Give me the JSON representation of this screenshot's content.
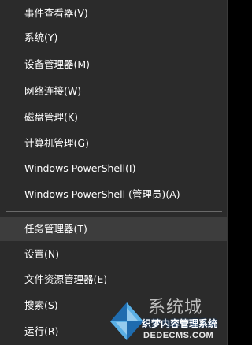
{
  "menu": {
    "items": [
      {
        "label": "事件查看器(V)"
      },
      {
        "label": "系统(Y)"
      },
      {
        "label": "设备管理器(M)"
      },
      {
        "label": "网络连接(W)"
      },
      {
        "label": "磁盘管理(K)"
      },
      {
        "label": "计算机管理(G)"
      },
      {
        "label": "Windows PowerShell(I)"
      },
      {
        "label": "Windows PowerShell (管理员)(A)"
      },
      {
        "label": "任务管理器(T)"
      },
      {
        "label": "设置(N)"
      },
      {
        "label": "文件资源管理器(E)"
      },
      {
        "label": "搜索(S)"
      },
      {
        "label": "运行(R)"
      }
    ],
    "highlighted_index": 8
  },
  "watermark": {
    "brand": "系统城",
    "name": "织梦内容管理系统",
    "site": "DEDECMS.COM"
  },
  "colors": {
    "menu_background": "#2b2b2b",
    "highlight_background": "#3d3d3d",
    "text": "#ffffff",
    "separator": "#6a6a6a",
    "logo_blue": "#1e73be",
    "logo_light_blue": "#5fb4e8"
  }
}
